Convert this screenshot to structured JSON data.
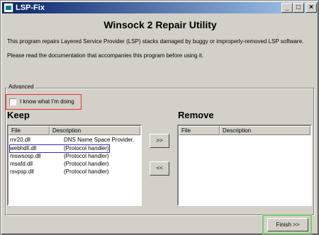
{
  "window": {
    "title": "LSP-Fix",
    "minimize_glyph": "_",
    "maximize_glyph": "□",
    "close_glyph": "×"
  },
  "heading": "Winsock 2 Repair Utility",
  "intro": [
    "This program repairs Layered Service Provider (LSP) stacks damaged by buggy or improperly-removed LSP software.",
    "Please read the documentation that accompanies this program before using it."
  ],
  "advanced": {
    "legend": "Advanced",
    "checkbox_label": "I know what I'm doing",
    "checkbox_checked": false
  },
  "keep": {
    "title": "Keep",
    "columns": [
      "File",
      "Description"
    ],
    "rows": [
      {
        "file": "rnr20.dll",
        "description": "DNS Name Space Provider."
      },
      {
        "file": "webhdll.dll",
        "description": "(Protocol handler)"
      },
      {
        "file": "mswsosp.dll",
        "description": "(Protocol handler)"
      },
      {
        "file": "msafd.dll",
        "description": "(Protocol handler)"
      },
      {
        "file": "rsvpsp.dll",
        "description": "(Protocol handler)"
      }
    ],
    "highlighted_row": 1
  },
  "remove": {
    "title": "Remove",
    "columns": [
      "File",
      "Description"
    ],
    "rows": []
  },
  "buttons": {
    "move_right": ">>",
    "move_left": "<<",
    "finish": "Finish >>"
  },
  "colors": {
    "titlebar_start": "#0a246a",
    "titlebar_end": "#a6caf0",
    "face": "#d4d0c8",
    "checkbox_highlight": "#e8302d",
    "row_highlight": "#3a2aa8",
    "finish_highlight": "#77d069"
  }
}
